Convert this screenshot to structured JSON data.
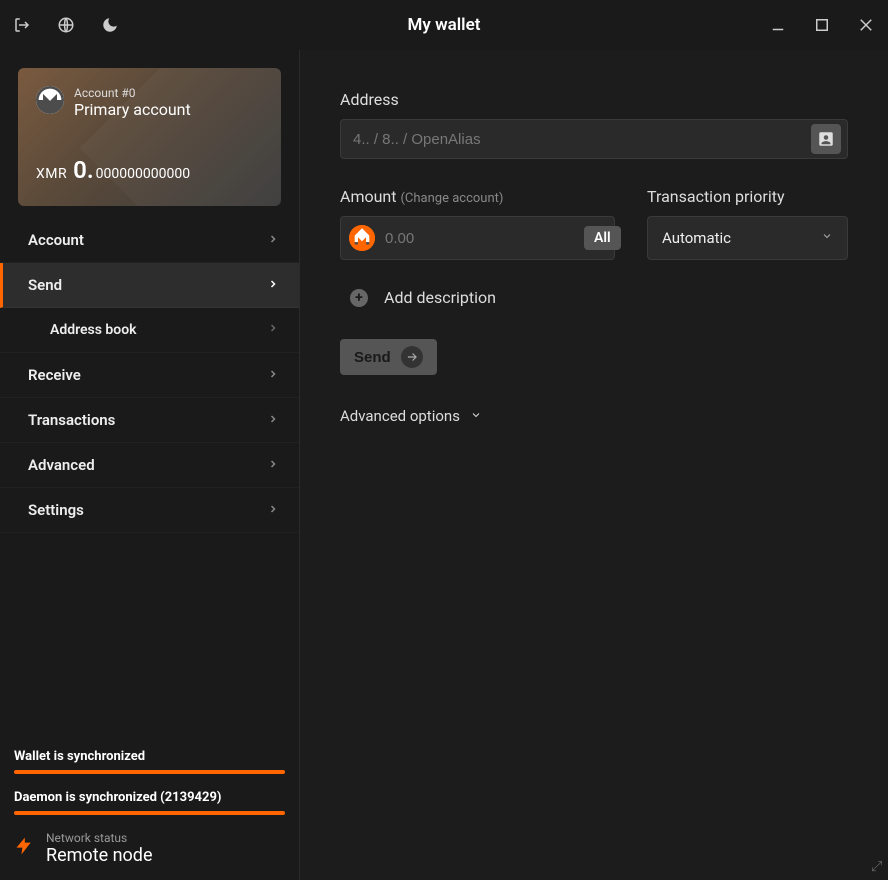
{
  "titlebar": {
    "title": "My wallet"
  },
  "account_card": {
    "account_id": "Account #0",
    "account_name": "Primary account",
    "currency": "XMR",
    "balance_whole": "0.",
    "balance_frac": "000000000000"
  },
  "nav": {
    "items": [
      {
        "label": "Account"
      },
      {
        "label": "Send"
      },
      {
        "label": "Receive"
      },
      {
        "label": "Transactions"
      },
      {
        "label": "Advanced"
      },
      {
        "label": "Settings"
      }
    ],
    "sub_items": [
      {
        "label": "Address book"
      }
    ]
  },
  "sync": {
    "wallet_label": "Wallet is synchronized",
    "daemon_label": "Daemon is synchronized (2139429)"
  },
  "network": {
    "label": "Network status",
    "value": "Remote node"
  },
  "send": {
    "address_label": "Address",
    "address_placeholder": "4.. / 8.. / OpenAlias",
    "amount_label": "Amount",
    "amount_sub": "(Change account)",
    "amount_placeholder": "0.00",
    "all_label": "All",
    "priority_label": "Transaction priority",
    "priority_value": "Automatic",
    "add_description": "Add description",
    "send_button": "Send",
    "advanced_options": "Advanced options"
  }
}
